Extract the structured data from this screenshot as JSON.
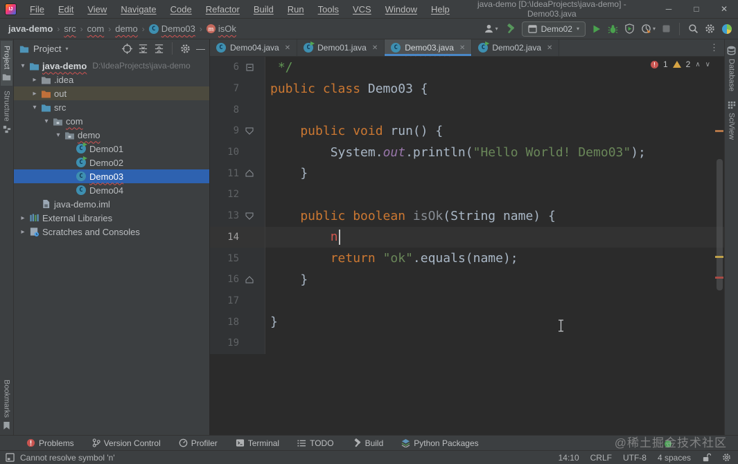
{
  "palette": {
    "accent_blue": "#4a88c7",
    "error_red": "#d25252",
    "selection_blue": "#2e62b0",
    "run_green": "#4d9950"
  },
  "title_bar": {
    "logo": "IJ",
    "menus": [
      "File",
      "Edit",
      "View",
      "Navigate",
      "Code",
      "Refactor",
      "Build",
      "Run",
      "Tools",
      "VCS",
      "Window",
      "Help"
    ],
    "title": "java-demo [D:\\IdeaProjects\\java-demo] - Demo03.java",
    "window_buttons": {
      "minimize": "─",
      "maximize": "□",
      "close": "✕"
    }
  },
  "nav_bar": {
    "breadcrumbs": [
      {
        "label": "java-demo",
        "bold": true,
        "error": false
      },
      {
        "label": "src",
        "error": true
      },
      {
        "label": "com",
        "error": true
      },
      {
        "label": "demo",
        "error": true
      },
      {
        "label": "Demo03",
        "icon": "class",
        "error": true
      },
      {
        "label": "isOk",
        "icon": "method",
        "error": true
      }
    ],
    "run_config_label": "Demo02"
  },
  "left_stripe": {
    "top": [
      {
        "label": "Project",
        "icon": "project",
        "active": true
      },
      {
        "label": "Structure",
        "icon": "structure",
        "active": false
      }
    ],
    "bottom": [
      {
        "label": "Bookmarks",
        "icon": "bookmarks",
        "active": false
      }
    ]
  },
  "right_stripe": {
    "top": [
      {
        "label": "Database",
        "icon": "database",
        "active": false
      },
      {
        "label": "SciView",
        "icon": "sciview",
        "active": false
      }
    ]
  },
  "project_panel": {
    "header_title": "Project",
    "tree": [
      {
        "label": "java-demo",
        "hint": "D:\\IdeaProjects\\java-demo",
        "icon": "folder-blue",
        "chevron": "open",
        "depth": 0,
        "bold": true,
        "error": true
      },
      {
        "label": ".idea",
        "icon": "folder-gray",
        "chevron": "closed",
        "depth": 1
      },
      {
        "label": "out",
        "icon": "folder-orange",
        "chevron": "closed",
        "depth": 1,
        "hover": true
      },
      {
        "label": "src",
        "icon": "folder-blue",
        "chevron": "open",
        "depth": 1
      },
      {
        "label": "com",
        "icon": "package",
        "chevron": "open",
        "depth": 2,
        "error": true
      },
      {
        "label": "demo",
        "icon": "package",
        "chevron": "open",
        "depth": 3,
        "error": true
      },
      {
        "label": "Demo01",
        "icon": "class-run",
        "depth": 4
      },
      {
        "label": "Demo02",
        "icon": "class-run",
        "depth": 4
      },
      {
        "label": "Demo03",
        "icon": "class",
        "depth": 4,
        "selected": true,
        "error": true
      },
      {
        "label": "Demo04",
        "icon": "class",
        "depth": 4
      },
      {
        "label": "java-demo.iml",
        "icon": "iml",
        "depth": 1
      },
      {
        "label": "External Libraries",
        "icon": "libs",
        "chevron": "closed",
        "depth": 0
      },
      {
        "label": "Scratches and Consoles",
        "icon": "scratch",
        "chevron": "closed",
        "depth": 0
      }
    ]
  },
  "editor": {
    "tabs": [
      {
        "label": "Demo04.java",
        "icon": "class",
        "active": false
      },
      {
        "label": "Demo01.java",
        "icon": "class-run",
        "active": false
      },
      {
        "label": "Demo03.java",
        "icon": "class",
        "active": true,
        "error": true
      },
      {
        "label": "Demo02.java",
        "icon": "class-run",
        "active": false
      }
    ],
    "inspections": {
      "errors": "1",
      "warnings": "2"
    },
    "lines": [
      {
        "num": "6",
        "fold": "box",
        "segs": [
          {
            "t": " */",
            "c": "comment"
          }
        ]
      },
      {
        "num": "7",
        "segs": [
          {
            "t": "public class",
            "c": "kw"
          },
          {
            "t": " Demo03 {",
            "c": "plain"
          }
        ]
      },
      {
        "num": "8",
        "segs": []
      },
      {
        "num": "9",
        "fold": "open",
        "segs": [
          {
            "t": "    public void",
            "c": "kw"
          },
          {
            "t": " run() {",
            "c": "plain"
          }
        ]
      },
      {
        "num": "10",
        "segs": [
          {
            "t": "        System.",
            "c": "plain"
          },
          {
            "t": "out",
            "c": "field"
          },
          {
            "t": ".println(",
            "c": "plain"
          },
          {
            "t": "\"Hello World! Demo03\"",
            "c": "str"
          },
          {
            "t": ");",
            "c": "plain"
          }
        ]
      },
      {
        "num": "11",
        "fold": "end",
        "segs": [
          {
            "t": "    }",
            "c": "plain"
          }
        ]
      },
      {
        "num": "12",
        "segs": []
      },
      {
        "num": "13",
        "fold": "open",
        "segs": [
          {
            "t": "    public boolean",
            "c": "kw"
          },
          {
            "t": " isOk",
            "c": "unused"
          },
          {
            "t": "(String name) {",
            "c": "plain"
          }
        ]
      },
      {
        "num": "14",
        "current": true,
        "caret": true,
        "segs": [
          {
            "t": "        ",
            "c": "plain"
          },
          {
            "t": "n",
            "c": "error"
          }
        ]
      },
      {
        "num": "15",
        "segs": [
          {
            "t": "        return ",
            "c": "kw"
          },
          {
            "t": "\"ok\"",
            "c": "str"
          },
          {
            "t": ".equals(name);",
            "c": "plain"
          }
        ]
      },
      {
        "num": "16",
        "fold": "end",
        "segs": [
          {
            "t": "    }",
            "c": "plain"
          }
        ]
      },
      {
        "num": "17",
        "segs": []
      },
      {
        "num": "18",
        "segs": [
          {
            "t": "}",
            "c": "plain"
          }
        ]
      },
      {
        "num": "19",
        "segs": []
      }
    ]
  },
  "bottom_bar": {
    "buttons": [
      {
        "label": "Problems",
        "icon": "problems"
      },
      {
        "label": "Version Control",
        "icon": "branch"
      },
      {
        "label": "Profiler",
        "icon": "gauge"
      },
      {
        "label": "Terminal",
        "icon": "terminal"
      },
      {
        "label": "TODO",
        "icon": "todo"
      },
      {
        "label": "Build",
        "icon": "hammer-gray"
      },
      {
        "label": "Python Packages",
        "icon": "packages"
      }
    ]
  },
  "status_bar": {
    "message": "Cannot resolve symbol 'n'",
    "caret_pos": "14:10",
    "line_ending": "CRLF",
    "encoding": "UTF-8",
    "indent": "4 spaces"
  },
  "watermark": "@稀土掘金技术社区"
}
